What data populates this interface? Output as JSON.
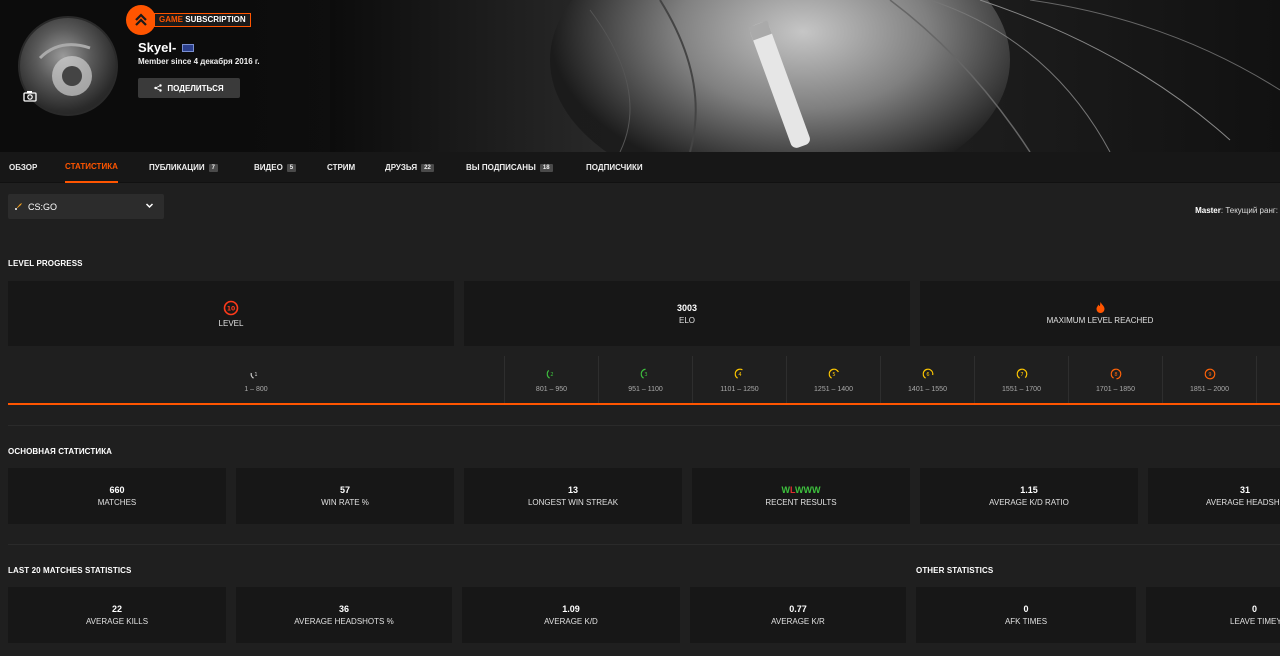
{
  "profile": {
    "subscription": {
      "prefix": "GAME",
      "suffix": "SUBSCRIPTION"
    },
    "username": "Skyel-",
    "member_since": "Member since 4 декабря 2016 г.",
    "share_label": "ПОДЕЛИТЬСЯ"
  },
  "tabs": [
    {
      "label": "ОБЗОР"
    },
    {
      "label": "СТАТИСТИКА",
      "active": true
    },
    {
      "label": "ПУБЛИКАЦИИ",
      "count": "7"
    },
    {
      "label": "ВИДЕО",
      "count": "5"
    },
    {
      "label": "СТРИМ"
    },
    {
      "label": "ДРУЗЬЯ",
      "count": "22"
    },
    {
      "label": "ВЫ ПОДПИСАНЫ",
      "count": "18"
    },
    {
      "label": "ПОДПИСЧИКИ"
    }
  ],
  "game_select": {
    "value": "CS:GO"
  },
  "rank": {
    "tier": "Master",
    "label": ": Текущий ранг:"
  },
  "level_progress": {
    "title": "LEVEL PROGRESS",
    "level": {
      "value": "10",
      "label": "LEVEL"
    },
    "elo": {
      "value": "3003",
      "label": "ELO"
    },
    "max": {
      "label": "MAXIMUM LEVEL REACHED"
    },
    "levels": [
      {
        "n": "1",
        "range": "1 – 800",
        "color": "#cccccc"
      },
      {
        "n": "2",
        "range": "801 – 950",
        "color": "#3ec13e"
      },
      {
        "n": "3",
        "range": "951 – 1100",
        "color": "#3ec13e"
      },
      {
        "n": "4",
        "range": "1101 – 1250",
        "color": "#ffc800"
      },
      {
        "n": "5",
        "range": "1251 – 1400",
        "color": "#ffc800"
      },
      {
        "n": "6",
        "range": "1401 – 1550",
        "color": "#ffc800"
      },
      {
        "n": "7",
        "range": "1551 – 1700",
        "color": "#ffc800"
      },
      {
        "n": "8",
        "range": "1701 – 1850",
        "color": "#ff6309"
      },
      {
        "n": "9",
        "range": "1851 – 2000",
        "color": "#ff6309"
      }
    ],
    "progress_fraction": 1.0
  },
  "main_stats": {
    "title": "ОСНОВНАЯ СТАТИСТИКА",
    "items": [
      {
        "value": "660",
        "label": "MATCHES"
      },
      {
        "value": "57",
        "label": "WIN RATE %"
      },
      {
        "value": "13",
        "label": "LONGEST WIN STREAK"
      },
      {
        "value": "",
        "label": "RECENT RESULTS"
      },
      {
        "value": "1.15",
        "label": "AVERAGE K/D RATIO"
      },
      {
        "value": "31",
        "label": "AVERAGE HEADSH"
      }
    ],
    "recent_results": [
      "W",
      "L",
      "W",
      "W",
      "W"
    ]
  },
  "last20": {
    "title": "LAST 20 MATCHES STATISTICS",
    "items": [
      {
        "value": "22",
        "label": "AVERAGE KILLS"
      },
      {
        "value": "36",
        "label": "AVERAGE HEADSHOTS %"
      },
      {
        "value": "1.09",
        "label": "AVERAGE K/D"
      },
      {
        "value": "0.77",
        "label": "AVERAGE K/R"
      }
    ]
  },
  "other": {
    "title": "OTHER STATISTICS",
    "items": [
      {
        "value": "0",
        "label": "AFK TIMES"
      },
      {
        "value": "0",
        "label": "LEAVE TIMEY"
      }
    ]
  },
  "colors": {
    "accent": "#ff5500",
    "card": "#171717",
    "bg": "#1f1f1f"
  }
}
